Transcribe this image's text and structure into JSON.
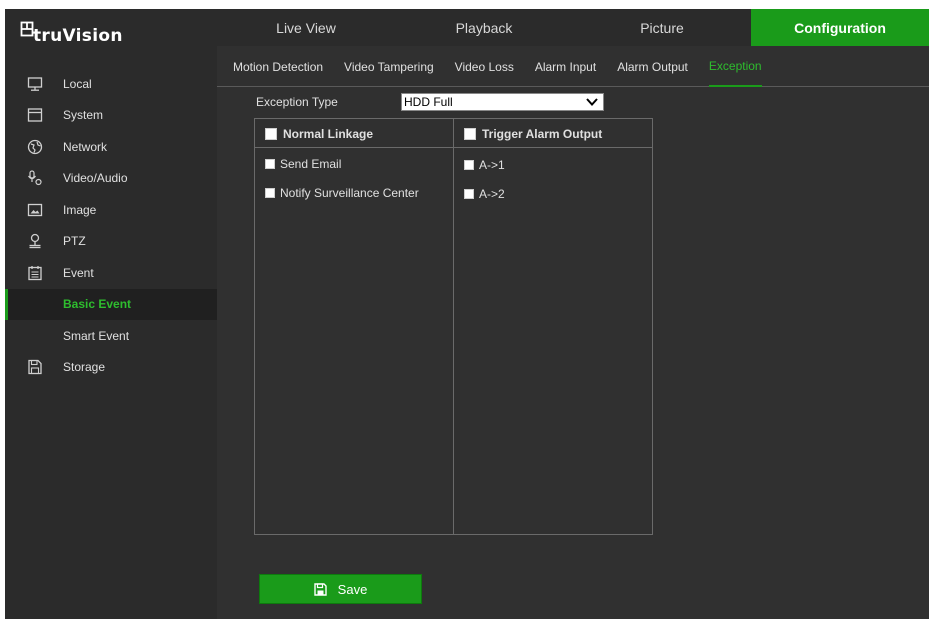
{
  "brand": {
    "name": "truVision"
  },
  "top_tabs": [
    {
      "label": "Live View"
    },
    {
      "label": "Playback"
    },
    {
      "label": "Picture"
    },
    {
      "label": "Configuration"
    }
  ],
  "sidebar": {
    "items": [
      {
        "label": "Local",
        "icon": "monitor-icon"
      },
      {
        "label": "System",
        "icon": "system-icon"
      },
      {
        "label": "Network",
        "icon": "globe-icon"
      },
      {
        "label": "Video/Audio",
        "icon": "microphone-icon"
      },
      {
        "label": "Image",
        "icon": "image-icon"
      },
      {
        "label": "PTZ",
        "icon": "ptz-icon"
      },
      {
        "label": "Event",
        "icon": "calendar-icon"
      },
      {
        "label": "Storage",
        "icon": "storage-icon"
      }
    ],
    "event_sub": [
      {
        "label": "Basic Event"
      },
      {
        "label": "Smart Event"
      }
    ]
  },
  "sub_tabs": [
    {
      "label": "Motion Detection"
    },
    {
      "label": "Video Tampering"
    },
    {
      "label": "Video Loss"
    },
    {
      "label": "Alarm Input"
    },
    {
      "label": "Alarm Output"
    },
    {
      "label": "Exception"
    }
  ],
  "exception": {
    "type_label": "Exception Type",
    "selected": "HDD Full"
  },
  "linkage": {
    "normal_header": "Normal Linkage",
    "trigger_header": "Trigger Alarm Output",
    "normal_items": [
      "Send Email",
      "Notify Surveillance Center"
    ],
    "trigger_items": [
      "A->1",
      "A->2"
    ]
  },
  "save_label": "Save",
  "colors": {
    "accent": "#1a9b1a",
    "active_text": "#2ebd2e",
    "background": "#303030",
    "sidebar": "#2b2b2b"
  }
}
